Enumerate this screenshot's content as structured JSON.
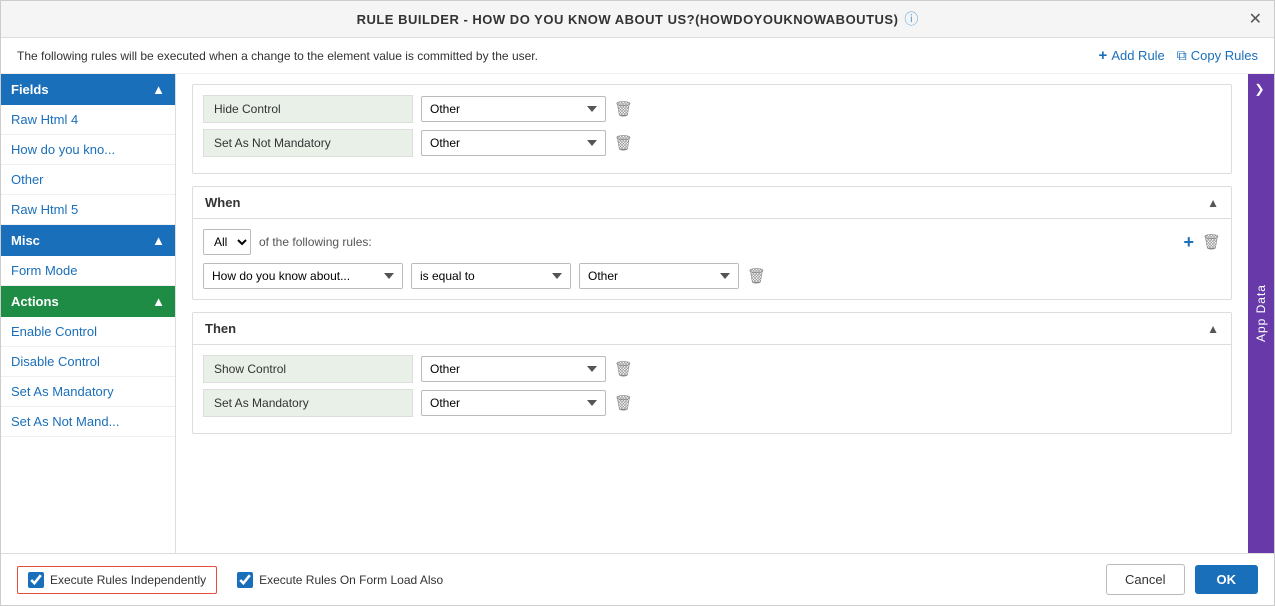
{
  "modal": {
    "title": "RULE BUILDER - HOW DO YOU KNOW ABOUT US?(HOWDOYOUKNOWABOUTUS)",
    "subheader_text": "The following rules will be executed when a change to the element value is committed by the user.",
    "add_rule_label": "Add Rule",
    "copy_rules_label": "Copy Rules"
  },
  "sidebar": {
    "fields_label": "Fields",
    "misc_label": "Misc",
    "actions_label": "Actions",
    "fields_items": [
      {
        "label": "Raw Html 4"
      },
      {
        "label": "How do you kno..."
      },
      {
        "label": "Other"
      },
      {
        "label": "Raw Html 5"
      }
    ],
    "misc_items": [
      {
        "label": "Form Mode"
      }
    ],
    "actions_items": [
      {
        "label": "Enable Control"
      },
      {
        "label": "Disable Control"
      },
      {
        "label": "Set As Mandatory"
      },
      {
        "label": "Set As Not Mand..."
      }
    ]
  },
  "rule_top": {
    "rows": [
      {
        "label": "Hide Control",
        "value": "Other"
      },
      {
        "label": "Set As Not Mandatory",
        "value": "Other"
      }
    ]
  },
  "when_section": {
    "title": "When",
    "all_label": "All",
    "of_following_label": "of the following rules:",
    "condition": {
      "field": "How do you know about...",
      "operator": "is equal to",
      "value": "Other"
    }
  },
  "then_section": {
    "title": "Then",
    "rows": [
      {
        "label": "Show Control",
        "value": "Other"
      },
      {
        "label": "Set As Mandatory",
        "value": "Other"
      }
    ]
  },
  "footer": {
    "execute_independently_label": "Execute Rules Independently",
    "execute_on_load_label": "Execute Rules On Form Load Also",
    "cancel_label": "Cancel",
    "ok_label": "OK"
  },
  "right_sidebar": {
    "label": "App Data"
  }
}
